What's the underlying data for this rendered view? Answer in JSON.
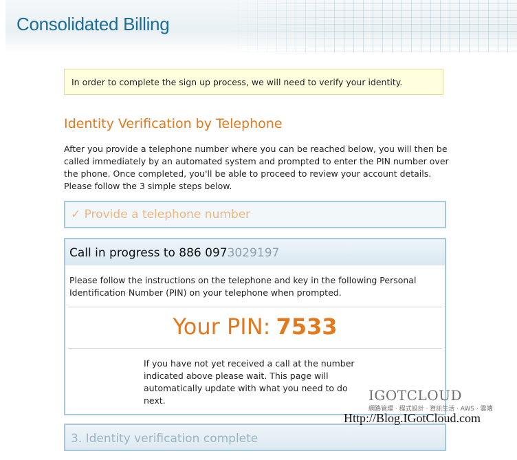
{
  "header": {
    "title": "Consolidated Billing"
  },
  "notice": {
    "text": "In order to complete the sign up process, we will need to verify your identity."
  },
  "section": {
    "title": "Identity Verification by Telephone",
    "intro": "After you provide a telephone number where you can be reached below, you will then be called immediately by an automated system and prompted to enter the PIN number over the phone. Once completed, you'll be able to proceed to review your account details. Please follow the 3 simple steps below."
  },
  "steps": {
    "step1_check": "✓",
    "step1_label": "Provide a telephone number",
    "step2_heading_prefix": "Call in progress to 886 097",
    "step2_heading_obscured": "3029197",
    "step3_label": "3. Identity verification complete"
  },
  "call": {
    "instructions": "Please follow the instructions on the telephone and key in the following Personal Identification Number (PIN) on your telephone when prompted.",
    "pin_label": "Your PIN:",
    "pin_code": "7533",
    "wait_text": "If you have not yet received a call at the number indicated above please wait. This page will automatically update with what you need to do next."
  },
  "watermark": {
    "brand": "IGOTCLOUD",
    "sub": "網路管理 · 程式設計 · 資訊生活 · AWS · 雲端",
    "url": "Http://Blog.IGotCloud.com"
  }
}
